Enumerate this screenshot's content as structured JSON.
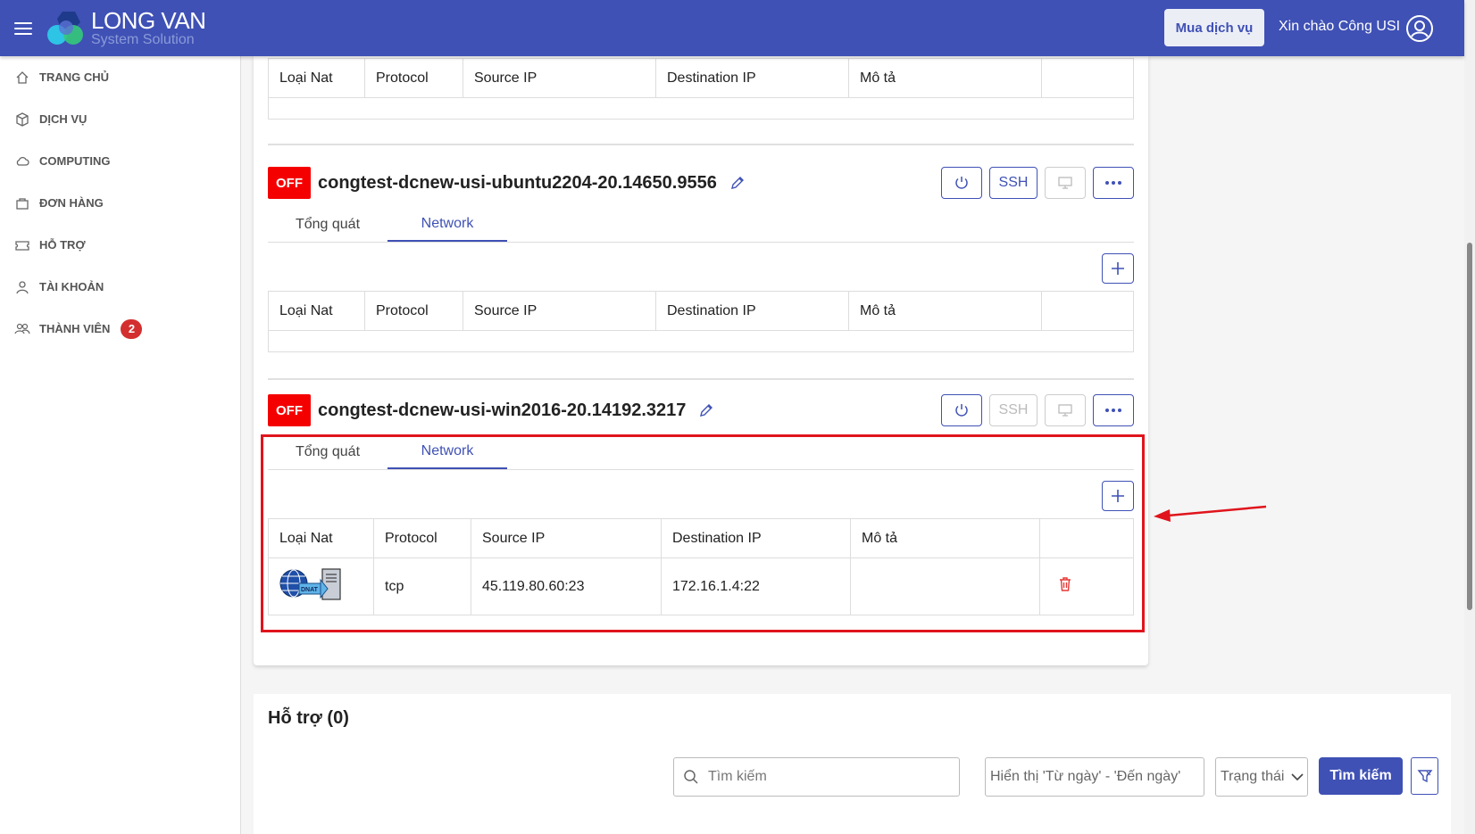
{
  "header": {
    "logo_name": "LONG VAN",
    "logo_sub": "System Solution",
    "buy_label": "Mua dịch vụ",
    "greeting": "Xin chào Công USI"
  },
  "sidebar": {
    "items": [
      {
        "label": "TRANG CHỦ",
        "icon": "home-icon"
      },
      {
        "label": "DỊCH VỤ",
        "icon": "box-icon"
      },
      {
        "label": "COMPUTING",
        "icon": "cloud-icon"
      },
      {
        "label": "ĐƠN HÀNG",
        "icon": "bag-icon"
      },
      {
        "label": "HỖ TRỢ",
        "icon": "ticket-icon"
      },
      {
        "label": "TÀI KHOẢN",
        "icon": "user-icon"
      },
      {
        "label": "THÀNH VIÊN",
        "icon": "group-icon",
        "badge": "2"
      }
    ]
  },
  "table_headers": [
    "Loại Nat",
    "Protocol",
    "Source IP",
    "Destination IP",
    "Mô tả",
    ""
  ],
  "vms": [
    {
      "status": "OFF",
      "name": "congtest-dcnew-usi-ubuntu2204-20.14650.9556",
      "ssh_label": "SSH",
      "tabs": [
        "Tổng quát",
        "Network"
      ],
      "active_tab": "Network"
    },
    {
      "status": "OFF",
      "name": "congtest-dcnew-usi-win2016-20.14192.3217",
      "ssh_label": "SSH",
      "tabs": [
        "Tổng quát",
        "Network"
      ],
      "active_tab": "Network",
      "rules": [
        {
          "nat_type": "DNAT",
          "protocol": "tcp",
          "source_ip": "45.119.80.60:23",
          "destination_ip": "172.16.1.4:22",
          "description": ""
        }
      ]
    }
  ],
  "support": {
    "title": "Hỗ trợ (0)",
    "search_placeholder": "Tìm kiếm",
    "date_placeholder": "Hiển thị 'Từ ngày' - 'Đến ngày'",
    "status_placeholder": "Trạng thái",
    "search_button": "Tìm kiếm"
  },
  "colors": {
    "primary": "#3f51b5",
    "off": "#f50000",
    "highlight": "#e0141c"
  }
}
